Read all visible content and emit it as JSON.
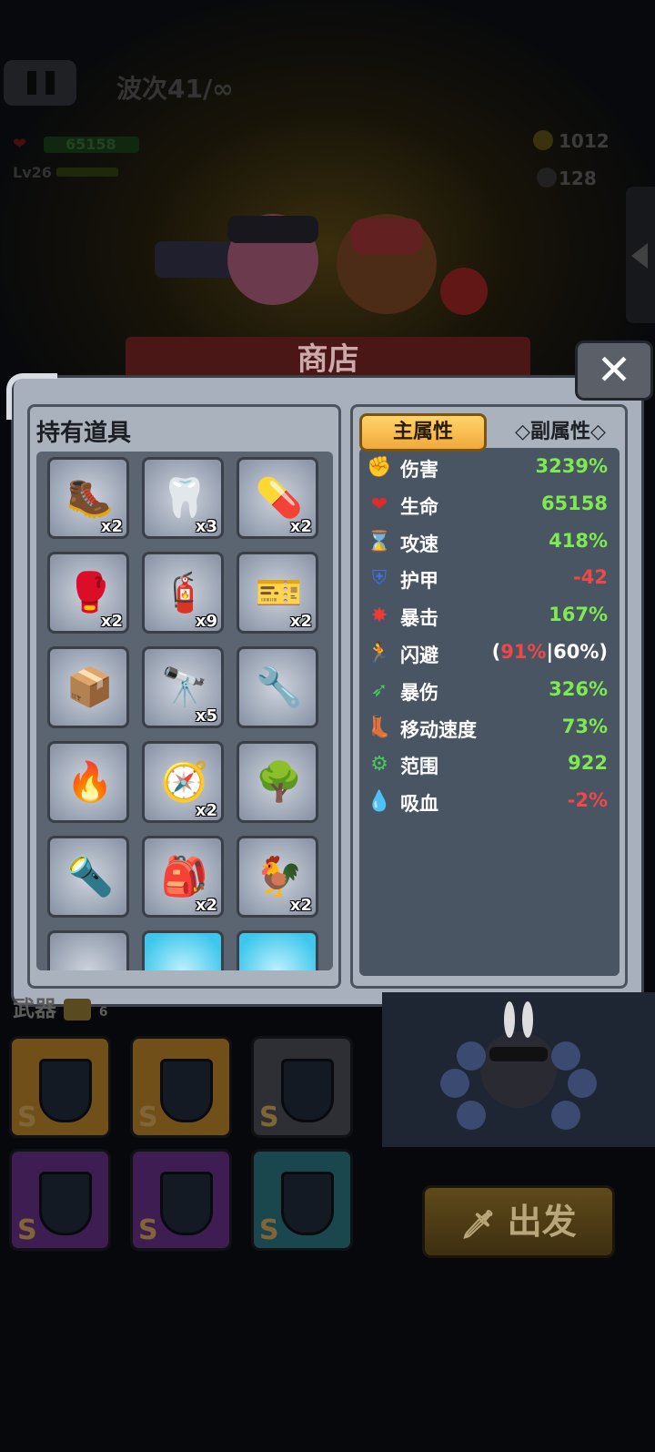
{
  "hud": {
    "wave": "波次41/∞",
    "hp": "65158",
    "level": "Lv26",
    "gold": "1012",
    "gems": "128"
  },
  "shop": {
    "title": "商店",
    "close_icon": "✕"
  },
  "inventory": {
    "title": "持有道具",
    "items": [
      {
        "icon": "boot-icon",
        "glyph": "🥾",
        "count": "x2"
      },
      {
        "icon": "dentures-icon",
        "glyph": "🦷",
        "count": "x3"
      },
      {
        "icon": "pill-bottle-icon",
        "glyph": "💊",
        "count": "x2"
      },
      {
        "icon": "brass-knuckles-icon",
        "glyph": "🥊",
        "count": "x2"
      },
      {
        "icon": "fire-extinguisher-icon",
        "glyph": "🧯",
        "count": "x9"
      },
      {
        "icon": "ticket-icon",
        "glyph": "🎫",
        "count": "x2"
      },
      {
        "icon": "cigarette-pack-icon",
        "glyph": "📦",
        "count": ""
      },
      {
        "icon": "binoculars-icon",
        "glyph": "🔭",
        "count": "x5"
      },
      {
        "icon": "wrench-icon",
        "glyph": "🔧",
        "count": ""
      },
      {
        "icon": "lighter-icon",
        "glyph": "🔥",
        "count": ""
      },
      {
        "icon": "compass-icon",
        "glyph": "🧭",
        "count": "x2"
      },
      {
        "icon": "tree-icon",
        "glyph": "🌳",
        "count": ""
      },
      {
        "icon": "flashlight-icon",
        "glyph": "🔦",
        "count": ""
      },
      {
        "icon": "backpack-icon",
        "glyph": "🎒",
        "count": "x2"
      },
      {
        "icon": "rooster-icon",
        "glyph": "🐓",
        "count": "x2"
      }
    ]
  },
  "stats": {
    "tab_main": "主属性",
    "tab_sub": "◇副属性◇",
    "rows": [
      {
        "name": "伤害",
        "value": "3239%",
        "color": "#7dea4f",
        "icon": "fist-icon",
        "glyph": "✊",
        "icolor": "#e04848"
      },
      {
        "name": "生命",
        "value": "65158",
        "color": "#7dea4f",
        "icon": "heart-icon",
        "glyph": "❤",
        "icolor": "#e02b2b"
      },
      {
        "name": "攻速",
        "value": "418%",
        "color": "#7dea4f",
        "icon": "hourglass-icon",
        "glyph": "⌛",
        "icolor": "#f3c447"
      },
      {
        "name": "护甲",
        "value": "-42",
        "color": "#ef4848",
        "icon": "shield-icon",
        "glyph": "⛨",
        "icolor": "#3f6fe0"
      },
      {
        "name": "暴击",
        "value": "167%",
        "color": "#7dea4f",
        "icon": "crit-burst-icon",
        "glyph": "✸",
        "icolor": "#ef3a3a"
      },
      {
        "name": "闪避",
        "value_prefix": "(",
        "value_red": "91%",
        "value_sep": "|",
        "value_white": "60%",
        "value_suffix": ")",
        "icon": "dodge-runner-icon",
        "glyph": "🏃",
        "icolor": "#4a8ef0"
      },
      {
        "name": "暴伤",
        "value": "326%",
        "color": "#7dea4f",
        "icon": "crit-damage-arrow-icon",
        "glyph": "➶",
        "icolor": "#47c95a"
      },
      {
        "name": "移动速度",
        "value": "73%",
        "color": "#7dea4f",
        "icon": "boot-speed-icon",
        "glyph": "👢",
        "icolor": "#4aa2f0"
      },
      {
        "name": "范围",
        "value": "922",
        "color": "#7dea4f",
        "icon": "range-gear-icon",
        "glyph": "⚙",
        "icolor": "#47c95a"
      },
      {
        "name": "吸血",
        "value": "-2%",
        "color": "#ef4848",
        "icon": "blood-drop-icon",
        "glyph": "💧",
        "icolor": "#e03030"
      }
    ]
  },
  "weapons": {
    "label": "武器",
    "count": "6",
    "slot_rank": "S",
    "slot_colors": [
      "#c88a25",
      "#c88a25",
      "#4c4f57",
      "#6b2f8f",
      "#6b2f8f",
      "#2a7b86"
    ]
  },
  "depart": {
    "label": "出发"
  }
}
